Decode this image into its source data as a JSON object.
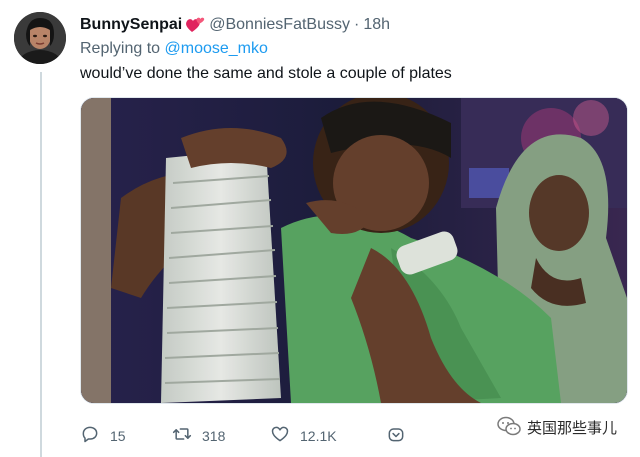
{
  "tweet": {
    "display_name": "BunnySenpai",
    "name_emoji_icon": "two-hearts-icon",
    "handle": "@BonniesFatBussy",
    "separator": "·",
    "time": "18h",
    "replying_to_prefix": "Replying to",
    "replying_to_handle": "@moose_mko",
    "text": "would’ve done the same and stole a couple of plates"
  },
  "media": {
    "description_icon": "video-still-image"
  },
  "actions": {
    "reply_count": "15",
    "retweet_count": "318",
    "like_count": "12.1K",
    "share_icon": "share-icon"
  },
  "watermark": {
    "text": "英国那些事儿",
    "icon": "wechat-icon"
  },
  "colors": {
    "link": "#1d9bf0",
    "secondary_text": "#536471",
    "heart_emoji": "#e0245e"
  }
}
